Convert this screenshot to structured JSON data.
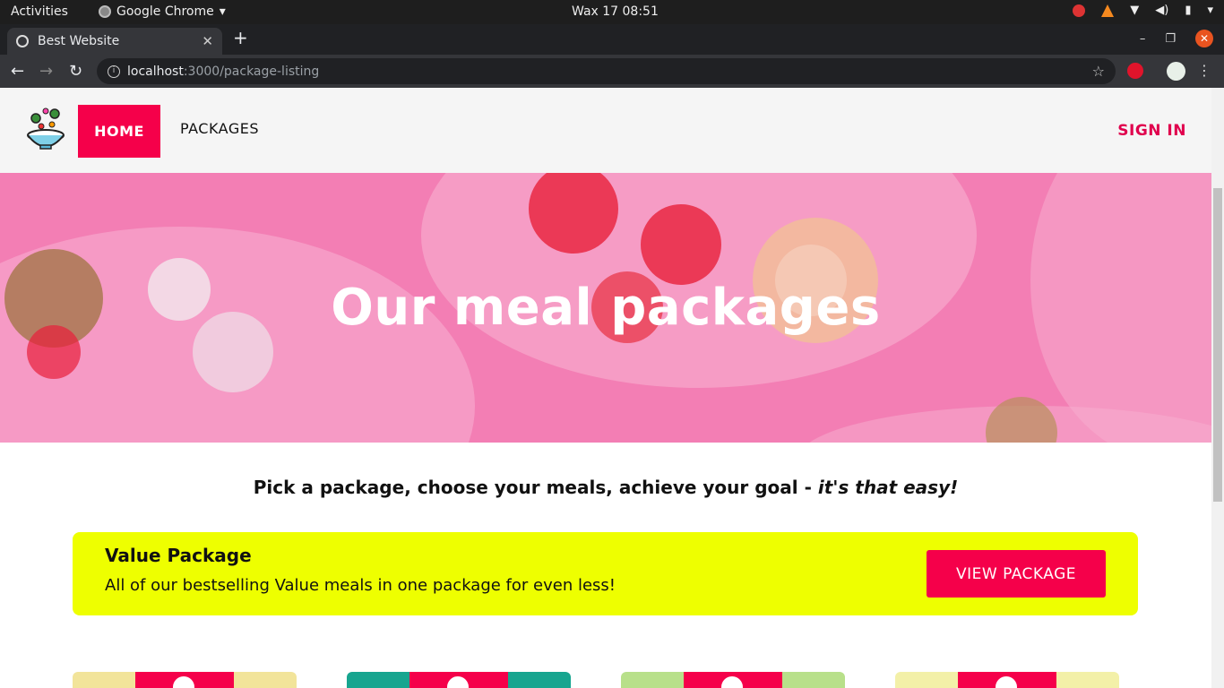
{
  "os": {
    "activities": "Activities",
    "app_name": "Google Chrome",
    "clock": "Wax 17  08:51"
  },
  "browser": {
    "tab_title": "Best Website",
    "url_host": "localhost",
    "url_path": ":3000/package-listing"
  },
  "header": {
    "nav_home": "HOME",
    "nav_packages": "PACKAGES",
    "sign_in": "SIGN IN"
  },
  "hero": {
    "title": "Our meal packages"
  },
  "tagline": {
    "main": "Pick a package, choose your meals, achieve your goal - ",
    "emphasis": "it's that easy!"
  },
  "promo": {
    "title": "Value Package",
    "description": "All of our bestselling Value meals in one package for even less!",
    "button": "VIEW PACKAGE"
  },
  "cards": [
    {
      "bg": "#f2e49a"
    },
    {
      "bg": "#17a58f"
    },
    {
      "bg": "#b8e08a"
    },
    {
      "bg": "#f3f0a8"
    }
  ],
  "colors": {
    "accent": "#f5004a",
    "hero_overlay": "#f37eb4",
    "promo_bg": "#eeff00"
  }
}
